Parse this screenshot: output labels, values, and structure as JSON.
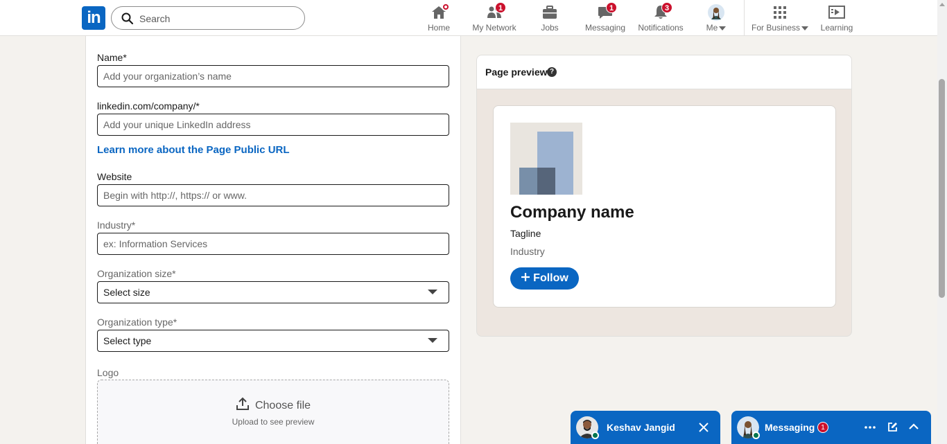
{
  "nav": {
    "logo": "in",
    "search_placeholder": "Search",
    "items": [
      {
        "label": "Home",
        "badge": ""
      },
      {
        "label": "My Network",
        "badge": "1"
      },
      {
        "label": "Jobs",
        "badge": ""
      },
      {
        "label": "Messaging",
        "badge": "1"
      },
      {
        "label": "Notifications",
        "badge": "3"
      },
      {
        "label": "Me",
        "badge": ""
      },
      {
        "label": "For Business",
        "badge": ""
      },
      {
        "label": "Learning",
        "badge": ""
      }
    ]
  },
  "form": {
    "name_label": "Name*",
    "name_placeholder": "Add your organization’s name",
    "url_label": "linkedin.com/company/*",
    "url_placeholder": "Add your unique LinkedIn address",
    "learn_link": "Learn more about the Page Public URL",
    "website_label": "Website",
    "website_placeholder": "Begin with http://, https:// or www.",
    "industry_label": "Industry*",
    "industry_placeholder": "ex: Information Services",
    "size_label": "Organization size*",
    "size_value": "Select size",
    "type_label": "Organization type*",
    "type_value": "Select type",
    "logo_label": "Logo",
    "choose_file": "Choose file",
    "upload_hint": "Upload to see preview"
  },
  "preview": {
    "title": "Page preview",
    "help": "?",
    "company_name": "Company name",
    "tagline": "Tagline",
    "industry": "Industry",
    "follow": "Follow"
  },
  "messaging": {
    "chat_name": "Keshav Jangid",
    "panel_title": "Messaging",
    "panel_badge": "1"
  },
  "colors": {
    "brand": "#0a66c2",
    "badge": "#cb112d",
    "background": "#f4f2ee"
  }
}
